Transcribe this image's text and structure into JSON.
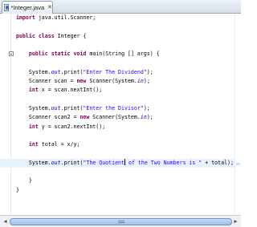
{
  "tab": {
    "title": "*Integer.java",
    "close_glyph": "✕",
    "icon": "java-file-icon"
  },
  "editor": {
    "lines": [
      [
        {
          "t": "import",
          "c": "kw"
        },
        {
          "t": " java.util.Scanner;"
        }
      ],
      [],
      [
        {
          "t": "public",
          "c": "kw"
        },
        {
          "t": " "
        },
        {
          "t": "class",
          "c": "kw"
        },
        {
          "t": " Integer {"
        }
      ],
      [],
      [
        {
          "t": "    "
        },
        {
          "t": "public",
          "c": "kw"
        },
        {
          "t": " "
        },
        {
          "t": "static",
          "c": "kw"
        },
        {
          "t": " "
        },
        {
          "t": "void",
          "c": "kw"
        },
        {
          "t": " main(String [] args) {"
        }
      ],
      [],
      [
        {
          "t": "    System."
        },
        {
          "t": "out",
          "c": "fld"
        },
        {
          "t": ".print("
        },
        {
          "t": "\"Enter The Dividend\"",
          "c": "str"
        },
        {
          "t": ");"
        }
      ],
      [
        {
          "t": "    Scanner scan = "
        },
        {
          "t": "new",
          "c": "kw"
        },
        {
          "t": " Scanner(System."
        },
        {
          "t": "in",
          "c": "fld"
        },
        {
          "t": ");"
        }
      ],
      [
        {
          "t": "    "
        },
        {
          "t": "int",
          "c": "kw"
        },
        {
          "t": " x = scan.nextInt();"
        }
      ],
      [],
      [
        {
          "t": "    System."
        },
        {
          "t": "out",
          "c": "fld"
        },
        {
          "t": ".print("
        },
        {
          "t": "\"Enter the Divisor\"",
          "c": "str"
        },
        {
          "t": ");"
        }
      ],
      [
        {
          "t": "    Scanner scan2 = "
        },
        {
          "t": "new",
          "c": "kw"
        },
        {
          "t": " Scanner(System."
        },
        {
          "t": "in",
          "c": "fld"
        },
        {
          "t": ");"
        }
      ],
      [
        {
          "t": "    "
        },
        {
          "t": "int",
          "c": "kw"
        },
        {
          "t": " y = scan2.nextInt();"
        }
      ],
      [],
      [
        {
          "t": "    "
        },
        {
          "t": "int",
          "c": "kw"
        },
        {
          "t": " total = x/y;"
        }
      ],
      [],
      [
        {
          "t": "    System."
        },
        {
          "t": "out",
          "c": "fld"
        },
        {
          "t": ".print("
        },
        {
          "t": "\"The Quotient",
          "c": "str"
        },
        {
          "caret": true
        },
        {
          "t": " of the Two Numbers is \"",
          "c": "str"
        },
        {
          "t": " + total);"
        }
      ],
      [],
      [
        {
          "t": "    }"
        }
      ],
      [
        {
          "t": "}"
        }
      ]
    ],
    "current_line": 16
  },
  "scrollbar": {
    "left_arrow": "◀",
    "right_arrow": "▶"
  }
}
